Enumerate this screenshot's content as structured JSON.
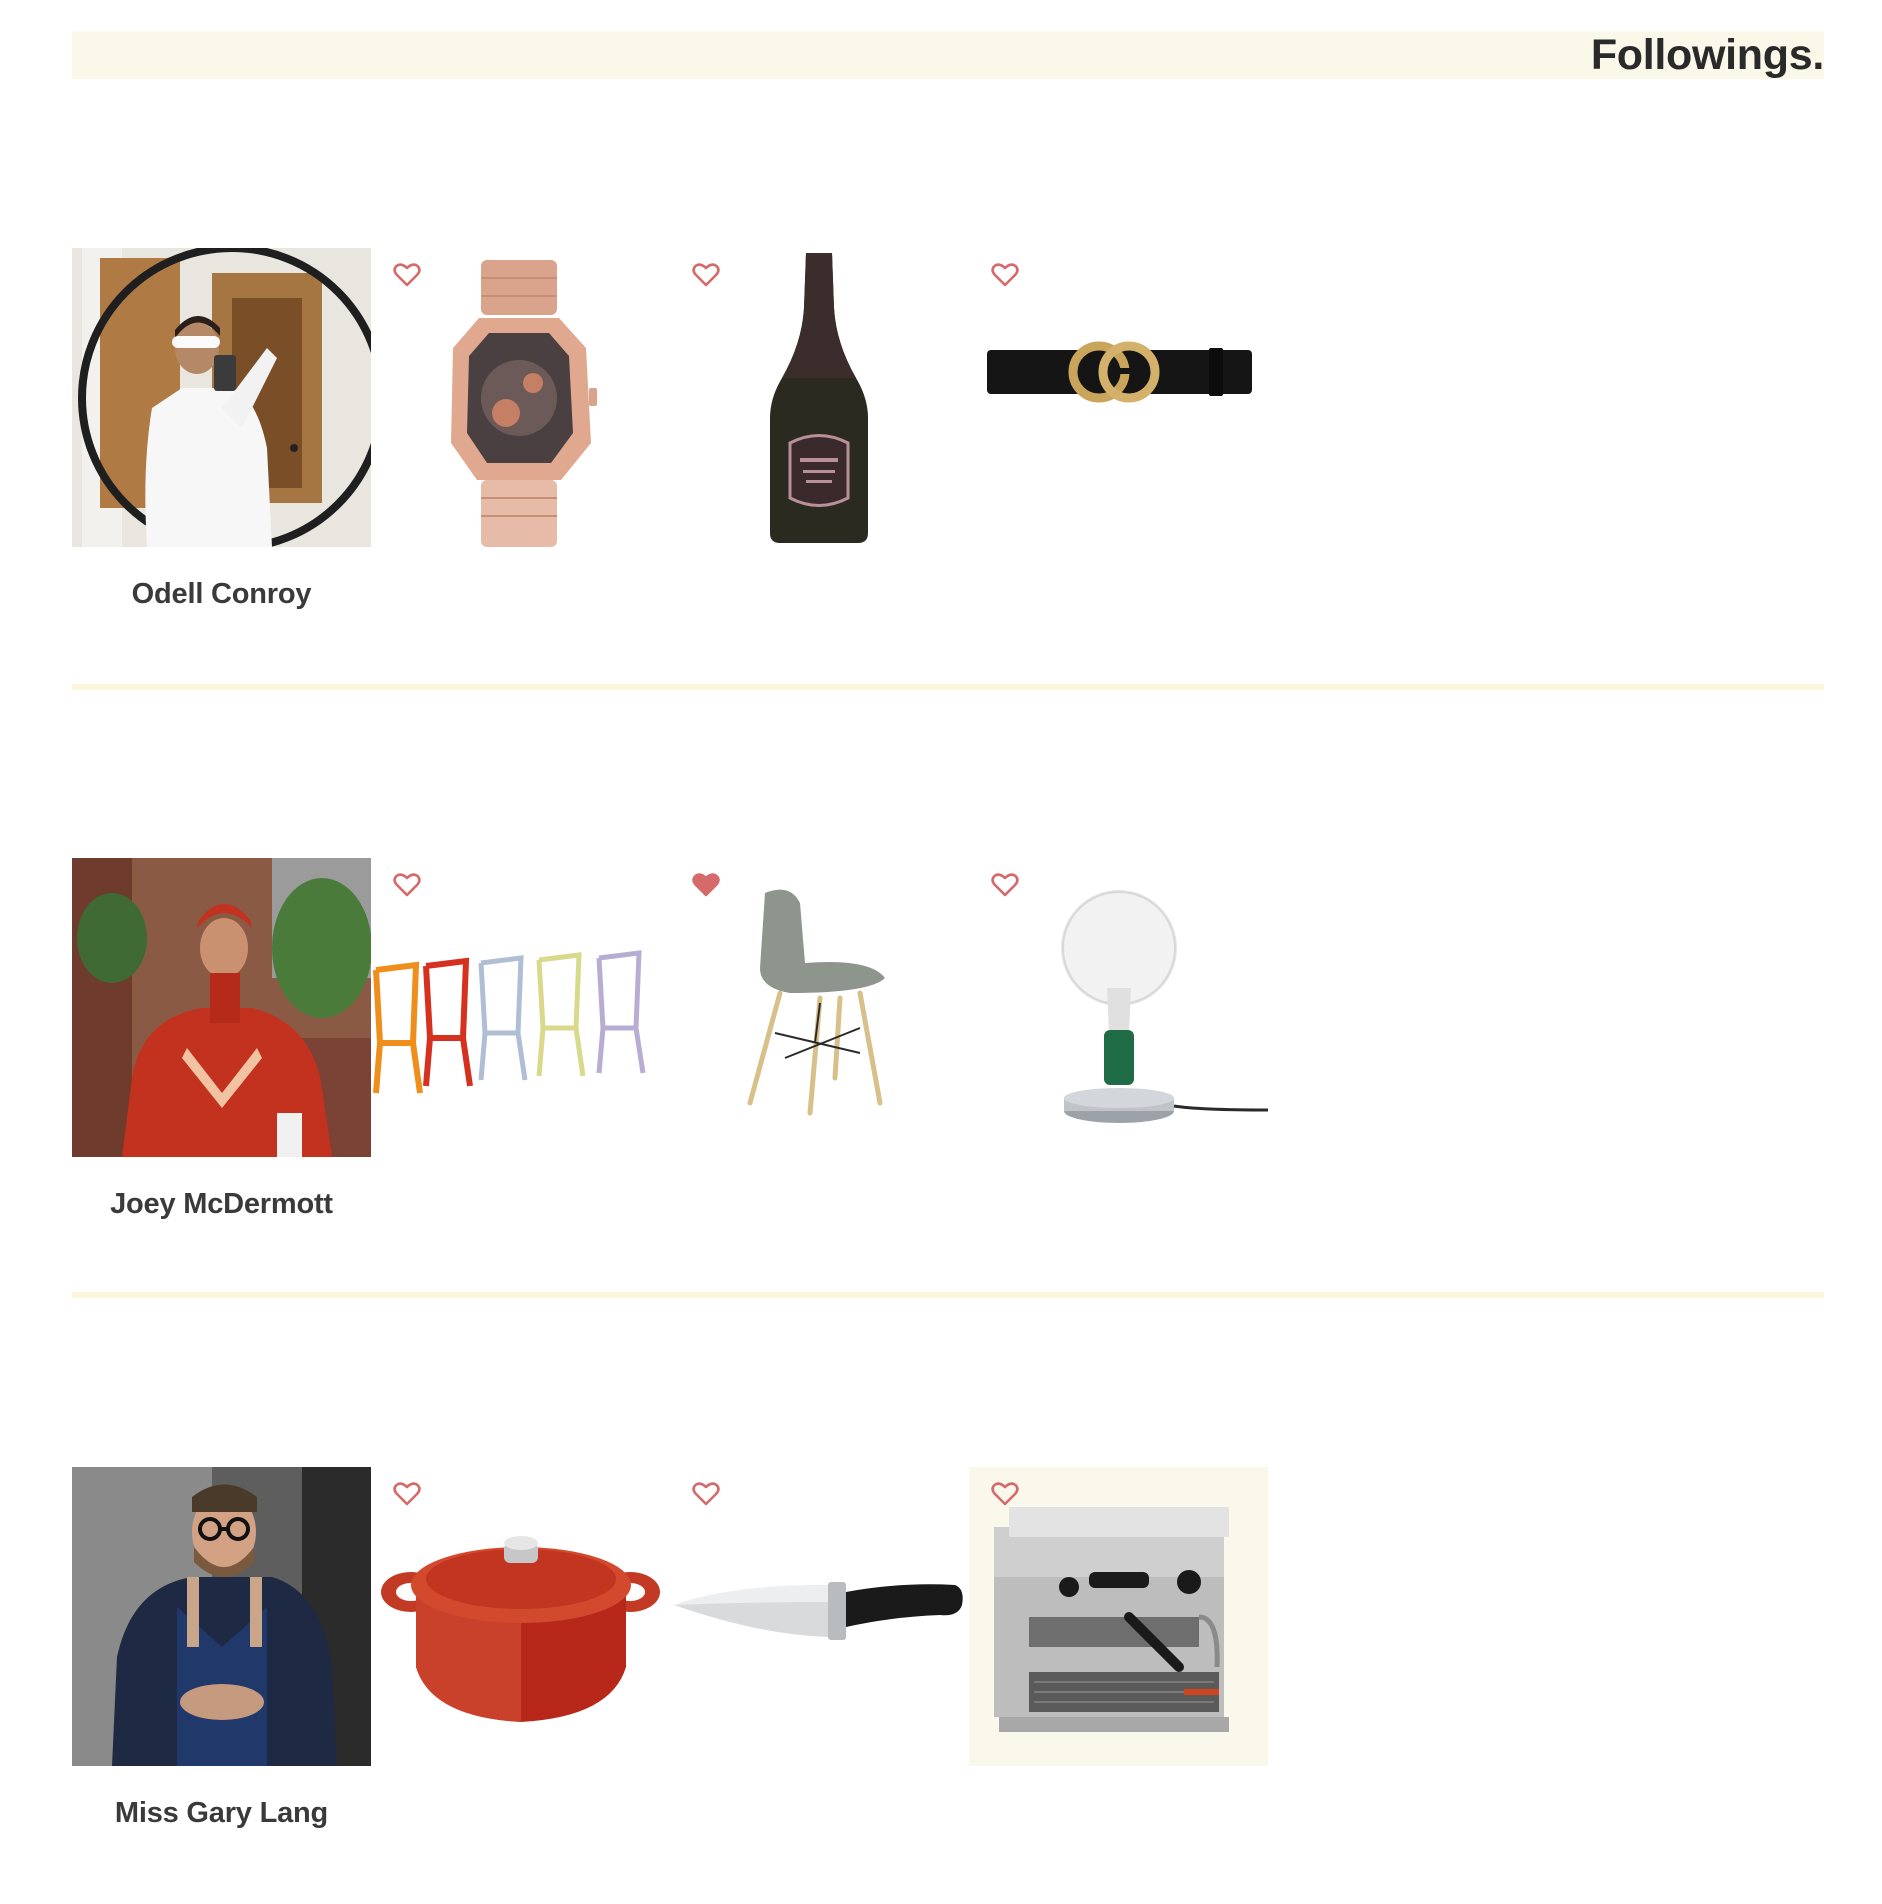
{
  "page": {
    "title": "Followings."
  },
  "followings": [
    {
      "name": "Odell Conroy",
      "products": [
        {
          "icon": "luxury-watch",
          "liked": false
        },
        {
          "icon": "champagne-bottle",
          "liked": false
        },
        {
          "icon": "designer-belt",
          "liked": false
        }
      ]
    },
    {
      "name": "Joey McDermott",
      "products": [
        {
          "icon": "acrylic-chairs",
          "liked": false
        },
        {
          "icon": "eames-chair",
          "liked": true
        },
        {
          "icon": "bulb-table-lamp",
          "liked": false
        }
      ]
    },
    {
      "name": "Miss Gary Lang",
      "products": [
        {
          "icon": "dutch-oven",
          "liked": false
        },
        {
          "icon": "chef-knife",
          "liked": false
        },
        {
          "icon": "espresso-machine",
          "liked": false
        }
      ]
    }
  ],
  "colors": {
    "heart": "#d46a6a",
    "header_bg": "#faf8e8",
    "divider": "#fcf6dc"
  }
}
